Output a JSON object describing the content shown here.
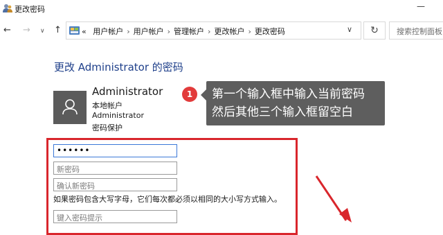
{
  "window": {
    "title": "更改密码",
    "minimize_glyph": "—"
  },
  "nav": {
    "back_glyph": "←",
    "forward_glyph": "→",
    "recent_glyph": "∨",
    "up_glyph": "↑",
    "breadcrumb_prefix": "«",
    "breadcrumbs": [
      "用户帐户",
      "用户帐户",
      "管理帐户",
      "更改帐户",
      "更改密码"
    ],
    "separator": "›",
    "dropdown_glyph": "∨",
    "refresh_glyph": "↻",
    "search_placeholder": "搜索控制面板"
  },
  "page": {
    "heading": "更改 Administrator 的密码"
  },
  "user": {
    "name": "Administrator",
    "type": "本地帐户",
    "group": "Administrator",
    "status": "密码保护"
  },
  "callout": {
    "number": "1",
    "line1": "第一个输入框中输入当前密码",
    "line2": "然后其他三个输入框留空白"
  },
  "form": {
    "current_password_value": "••••••",
    "new_password_placeholder": "新密码",
    "confirm_password_placeholder": "确认新密码",
    "case_hint": "如果密码包含大写字母，它们每次都必须以相同的大小写方式输入。",
    "password_hint_placeholder": "键入密码提示"
  },
  "colors": {
    "heading": "#1e3f8a",
    "highlight": "#d9262c",
    "callout_bg": "#5e5e5e",
    "badge": "#e23b3b",
    "avatar_bg": "#5b5b5b"
  },
  "icons": [
    "users-icon",
    "control-panel-icon",
    "user-avatar-icon",
    "refresh-icon"
  ]
}
